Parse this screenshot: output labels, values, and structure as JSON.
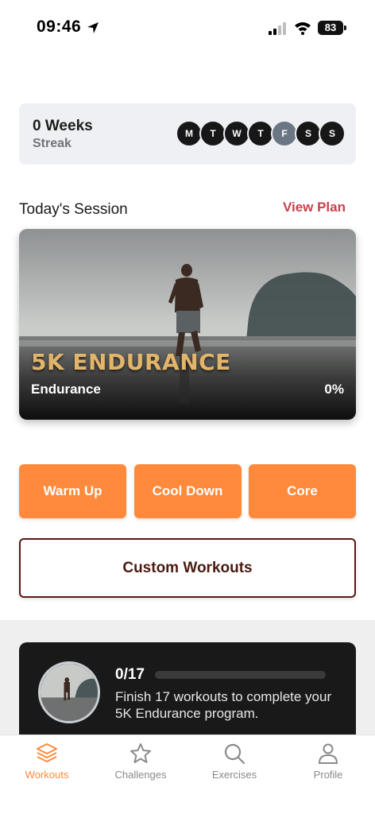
{
  "status_bar": {
    "time": "09:46",
    "battery": "83"
  },
  "streak": {
    "weeks": "0 Weeks",
    "label": "Streak",
    "days": [
      "M",
      "T",
      "W",
      "T",
      "F",
      "S",
      "S"
    ],
    "current_day_index": 4
  },
  "today": {
    "section_title": "Today's Session",
    "view_plan": "View Plan",
    "session": {
      "title": "5K ENDURANCE",
      "subtitle": "Endurance",
      "progress": "0%"
    }
  },
  "quick_actions": [
    "Warm Up",
    "Cool Down",
    "Core"
  ],
  "custom_workouts": "Custom Workouts",
  "program": {
    "count": "0/17",
    "completed": 0,
    "total": 17,
    "description": "Finish 17 workouts to complete your 5K Endurance program."
  },
  "tabs": [
    {
      "label": "Workouts",
      "icon": "layers-icon",
      "active": true
    },
    {
      "label": "Challenges",
      "icon": "star-icon",
      "active": false
    },
    {
      "label": "Exercises",
      "icon": "search-icon",
      "active": false
    },
    {
      "label": "Profile",
      "icon": "person-icon",
      "active": false
    }
  ],
  "colors": {
    "accent": "#ff8a3c",
    "link": "#c9404e",
    "dark": "#191919",
    "custom_border": "#5a1a12"
  }
}
